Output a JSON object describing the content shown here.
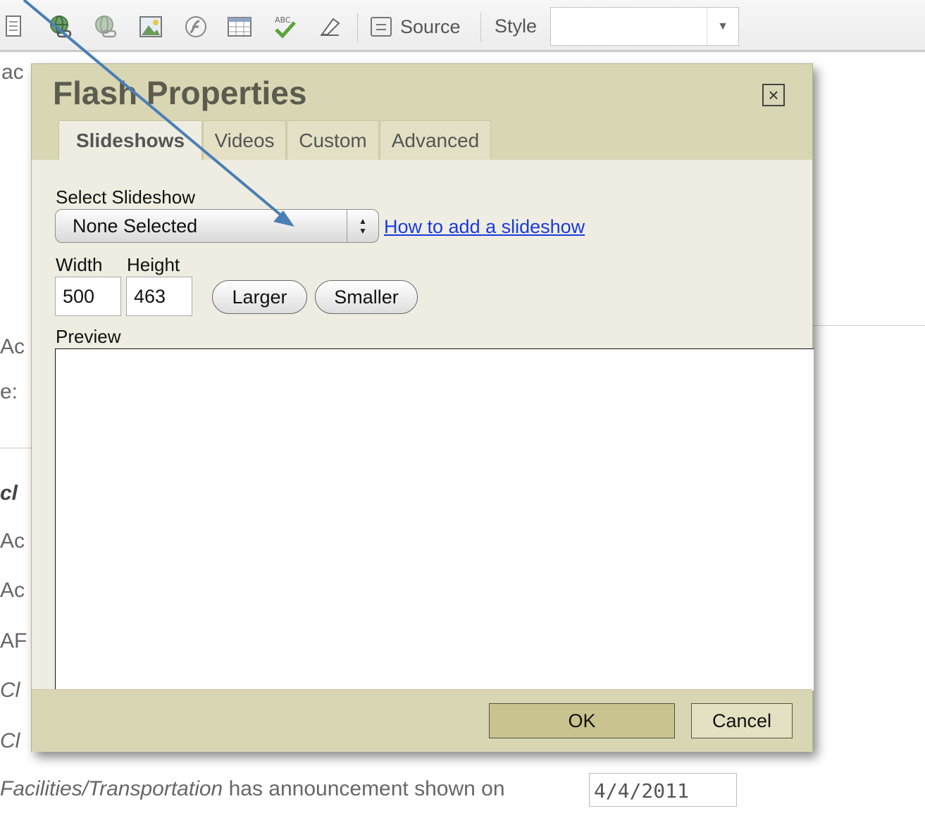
{
  "toolbar": {
    "source_label": "Source",
    "style_label": "Style",
    "style_value": ""
  },
  "background": {
    "line1": "ac",
    "line2": "Ac",
    "line3": "e:",
    "line4": "cl",
    "line5": "Ac",
    "line6": "Ac",
    "line7": "AF",
    "line8": "Cl",
    "line9": "Cl",
    "announcement_italic": "Facilities/Transportation",
    "announcement_rest": " has announcement shown on",
    "announcement_date": "4/4/2011"
  },
  "dialog": {
    "title": "Flash Properties",
    "close_glyph": "×",
    "tabs": [
      {
        "label": "Slideshows",
        "active": true
      },
      {
        "label": "Videos",
        "active": false
      },
      {
        "label": "Custom",
        "active": false
      },
      {
        "label": "Advanced",
        "active": false
      }
    ],
    "select_label": "Select Slideshow",
    "select_value": "None Selected",
    "help_link": "How to add a slideshow",
    "width_label": "Width",
    "height_label": "Height",
    "width_value": "500",
    "height_value": "463",
    "larger_label": "Larger",
    "smaller_label": "Smaller",
    "preview_label": "Preview",
    "ok_label": "OK",
    "cancel_label": "Cancel"
  },
  "colors": {
    "dialog_bg": "#efede1",
    "header_bg": "#d9d6b4",
    "ok_bg": "#c9c48f",
    "link": "#1a3ae0",
    "arrow": "#4a7fb5"
  }
}
